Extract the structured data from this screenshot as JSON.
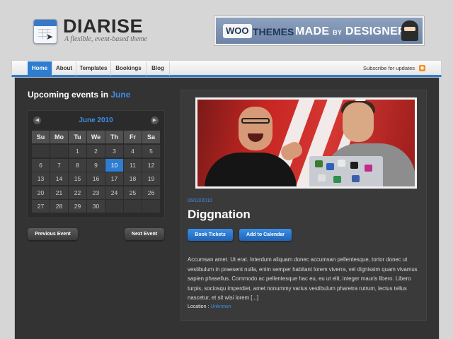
{
  "header": {
    "site_title": "DIARISE",
    "tagline": "A flexible, event-based theme"
  },
  "banner": {
    "woo": "WOO",
    "themes": "THEMES",
    "made": "MADE",
    "by": "BY",
    "designers": "DESIGNERS"
  },
  "nav": {
    "items": [
      "Home",
      "About",
      "Templates",
      "Bookings",
      "Blog"
    ],
    "active": "Home",
    "subscribe": "Subscribe for updates"
  },
  "upcoming": {
    "heading": "Upcoming events in",
    "month": "June"
  },
  "calendar": {
    "title": "June 2010",
    "prev_icon": "chevron-left-icon",
    "next_icon": "chevron-right-icon",
    "weekdays": [
      "Su",
      "Mo",
      "Tu",
      "We",
      "Th",
      "Fr",
      "Sa"
    ],
    "weeks": [
      [
        "",
        "",
        "1",
        "2",
        "3",
        "4",
        "5"
      ],
      [
        "6",
        "7",
        "8",
        "9",
        "10",
        "11",
        "12"
      ],
      [
        "13",
        "14",
        "15",
        "16",
        "17",
        "18",
        "19"
      ],
      [
        "20",
        "21",
        "22",
        "23",
        "24",
        "25",
        "26"
      ],
      [
        "27",
        "28",
        "29",
        "30",
        "",
        "",
        ""
      ]
    ],
    "highlighted_day": "10"
  },
  "pager": {
    "previous": "Previous Event",
    "next": "Next Event"
  },
  "event": {
    "date": "06/10/2010",
    "title": "Diggnation",
    "book_button": "Book Tickets",
    "calendar_button": "Add to Calendar",
    "description": "Accumsan amet. Ut erat. Interdum aliquam donec accumsan pellentesque, tortor donec ut vestibulum in praesent nulla, enim semper habitant lorem viverra, vel dignissim quam vivamus sapien phasellus. Commodo ac pellentesque hac eu, eu ut elit, integer mauris libero. Libero turpis, sociosqu imperdiet, amet nonummy varius vestibulum pharetra rutrum, lectus tellus nascetur, et sit wisi lorem [...]",
    "location_label": "Location :",
    "location_value": "Unknown"
  },
  "colors": {
    "accent": "#2e7dd1",
    "panel": "#333333",
    "background": "#d6d6d6"
  }
}
